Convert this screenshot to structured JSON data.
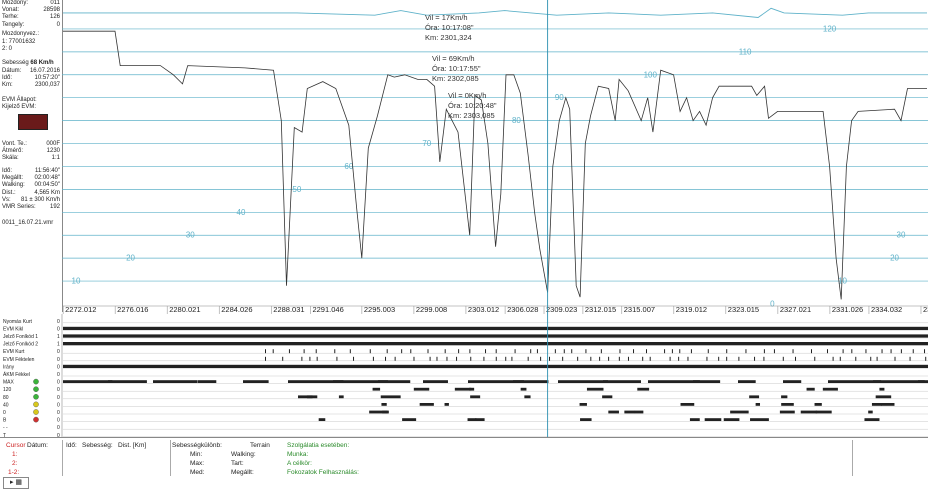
{
  "left_panel": {
    "rows_top": [
      {
        "k": "Mozdony:",
        "v": "011"
      },
      {
        "k": "Vonat:",
        "v": "28598"
      },
      {
        "k": "Terhe:",
        "v": "126"
      },
      {
        "k": "Tengely:",
        "v": "0"
      }
    ],
    "mozdonyvezeto_label": "Mozdonyvez.:",
    "mozdonyvezeto_1": "1: 77001632",
    "mozdonyvezeto_2": "2: 0",
    "sebesseg_label": "Sebesség",
    "sebesseg_value": "68 Km/h",
    "rows_mid": [
      {
        "k": "Dátum:",
        "v": "16.07.2016"
      },
      {
        "k": "Idő:",
        "v": "10:57:20\""
      },
      {
        "k": "Km:",
        "v": "2300,037"
      }
    ],
    "evm_allapot": "EVM Állapot:",
    "kijelzo_evm": "Kijelző EVM:",
    "rows_low": [
      {
        "k": "Vont. Te.:",
        "v": "000F"
      },
      {
        "k": "Átmérő:",
        "v": "1230"
      },
      {
        "k": "Skála:",
        "v": "1:1"
      }
    ],
    "rows_bottom": [
      {
        "k": "Idő:",
        "v": "11:56:40\""
      },
      {
        "k": "Megállt:",
        "v": "02:00:48\""
      },
      {
        "k": "Walking:",
        "v": "00:04:50\""
      },
      {
        "k": "Dist.:",
        "v": "4,565 Km"
      },
      {
        "k": "Vs:",
        "v": "81 ± 300 Km/h"
      },
      {
        "k": "VMR Series:",
        "v": "192"
      }
    ],
    "file": "0011_16.07.21.vmr"
  },
  "chart_data": {
    "type": "line",
    "ylim": [
      0,
      130
    ],
    "xlim": [
      2272.0,
      2338.5
    ],
    "x_tick_labels": [
      "2272.012",
      "2276.016",
      "2280.021",
      "2284.026",
      "2288.031",
      "2291.046",
      "2295.003",
      "2299.008",
      "2303.012",
      "2306.028",
      "2309.023",
      "2312.015",
      "2315.007",
      "2319.012",
      "2323.015",
      "2327.021",
      "2331.026",
      "2334.032",
      "2338.037"
    ],
    "speed_levels": [
      10,
      20,
      30,
      40,
      50,
      60,
      70,
      80,
      90,
      100,
      110,
      120
    ],
    "speed_labels": [
      {
        "v": "0",
        "x": 2326.6
      },
      {
        "v": "10",
        "x": 2273.0
      },
      {
        "v": "10",
        "x": 2332.0
      },
      {
        "v": "20",
        "x": 2277.2
      },
      {
        "v": "20",
        "x": 2336.0
      },
      {
        "v": "30",
        "x": 2281.8
      },
      {
        "v": "30",
        "x": 2336.5
      },
      {
        "v": "40",
        "x": 2285.7
      },
      {
        "v": "50",
        "x": 2290.0
      },
      {
        "v": "60",
        "x": 2294.0
      },
      {
        "v": "70",
        "x": 2300.0
      },
      {
        "v": "80",
        "x": 2306.9
      },
      {
        "v": "90",
        "x": 2310.2
      },
      {
        "v": "100",
        "x": 2317.2
      },
      {
        "v": "110",
        "x": 2324.5
      },
      {
        "v": "120",
        "x": 2331.0
      }
    ],
    "cursor_x": 2309.3,
    "speed_trace": [
      [
        2272.0,
        119
      ],
      [
        2276.0,
        119
      ],
      [
        2276.4,
        104
      ],
      [
        2279.5,
        104
      ],
      [
        2280.5,
        100
      ],
      [
        2281.2,
        96
      ],
      [
        2281.6,
        104
      ],
      [
        2286.0,
        103
      ],
      [
        2288.2,
        102
      ],
      [
        2288.8,
        80
      ],
      [
        2289.2,
        8
      ],
      [
        2289.8,
        77
      ],
      [
        2290.4,
        75
      ],
      [
        2290.8,
        94
      ],
      [
        2292.0,
        97
      ],
      [
        2293.0,
        94
      ],
      [
        2294.0,
        78
      ],
      [
        2294.6,
        42
      ],
      [
        2295.0,
        20
      ],
      [
        2295.5,
        68
      ],
      [
        2296.2,
        82
      ],
      [
        2297.0,
        100
      ],
      [
        2297.5,
        99
      ],
      [
        2298.3,
        100
      ],
      [
        2299.3,
        98
      ],
      [
        2300.0,
        98
      ],
      [
        2300.6,
        95
      ],
      [
        2301.0,
        62
      ],
      [
        2301.5,
        85
      ],
      [
        2302.4,
        75
      ],
      [
        2302.8,
        55
      ],
      [
        2303.3,
        30
      ],
      [
        2303.7,
        91
      ],
      [
        2304.2,
        89
      ],
      [
        2304.7,
        70
      ],
      [
        2305.3,
        25
      ],
      [
        2305.7,
        48
      ],
      [
        2306.1,
        100
      ],
      [
        2306.7,
        100
      ],
      [
        2307.2,
        92
      ],
      [
        2307.8,
        65
      ],
      [
        2308.3,
        40
      ],
      [
        2308.7,
        24
      ],
      [
        2309.3,
        5
      ],
      [
        2309.7,
        60
      ],
      [
        2310.2,
        80
      ],
      [
        2310.7,
        90
      ],
      [
        2311.0,
        85
      ],
      [
        2311.5,
        8
      ],
      [
        2311.8,
        3
      ],
      [
        2312.2,
        70
      ],
      [
        2312.6,
        82
      ],
      [
        2313.2,
        95
      ],
      [
        2314.0,
        94
      ],
      [
        2314.5,
        80
      ],
      [
        2314.8,
        98
      ],
      [
        2315.5,
        93
      ],
      [
        2316.5,
        80
      ],
      [
        2317.0,
        90
      ],
      [
        2317.4,
        75
      ],
      [
        2318.0,
        102
      ],
      [
        2319.0,
        100
      ],
      [
        2319.5,
        84
      ],
      [
        2320.0,
        90
      ],
      [
        2320.5,
        80
      ],
      [
        2321.0,
        84
      ],
      [
        2321.5,
        78
      ],
      [
        2322.0,
        90
      ],
      [
        2322.5,
        95
      ],
      [
        2325.0,
        95
      ],
      [
        2325.4,
        91
      ],
      [
        2326.0,
        95
      ],
      [
        2326.3,
        81
      ],
      [
        2327.0,
        84
      ],
      [
        2330.5,
        84
      ],
      [
        2331.0,
        60
      ],
      [
        2331.5,
        20
      ],
      [
        2331.9,
        2
      ],
      [
        2332.3,
        60
      ],
      [
        2332.7,
        80
      ],
      [
        2333.2,
        84
      ],
      [
        2336.0,
        85
      ],
      [
        2336.5,
        80
      ],
      [
        2337.0,
        94
      ],
      [
        2338.5,
        94
      ]
    ],
    "top_trace": [
      [
        2272.0,
        127
      ],
      [
        2276.0,
        127
      ],
      [
        2280.0,
        127
      ],
      [
        2285.0,
        127
      ],
      [
        2290.0,
        127
      ],
      [
        2296.0,
        126
      ],
      [
        2298.0,
        128
      ],
      [
        2300.0,
        126
      ],
      [
        2304.0,
        127
      ],
      [
        2306.0,
        128
      ],
      [
        2310.0,
        126
      ],
      [
        2314.0,
        127
      ],
      [
        2318.0,
        126
      ],
      [
        2322.0,
        127
      ],
      [
        2325.5,
        125
      ],
      [
        2326.5,
        129
      ],
      [
        2327.5,
        127
      ],
      [
        2332.0,
        126
      ],
      [
        2334.0,
        127
      ],
      [
        2338.5,
        127
      ]
    ],
    "annotations": [
      {
        "lines": [
          "Vil = 17Km/h",
          "Óra: 10:17:08\"",
          "Km: 2301,324"
        ]
      },
      {
        "lines": [
          "Vil = 69Km/h",
          "Óra: 10:17:55\"",
          "Km: 2302,085"
        ]
      },
      {
        "lines": [
          "Vil = 0Km/h",
          "Óra: 10:20:48\"",
          "Km: 2303,085"
        ]
      }
    ]
  },
  "digital": {
    "channels": [
      {
        "label": "Nyomás Kurt",
        "value": "0",
        "lamp": ""
      },
      {
        "label": "EVM Kikl",
        "value": "0",
        "lamp": ""
      },
      {
        "label": "Jelző Fonlkód 1",
        "value": "1",
        "lamp": ""
      },
      {
        "label": "Jelző Fonlkód 2",
        "value": "1",
        "lamp": ""
      },
      {
        "label": "EVM Kurt",
        "value": "0",
        "lamp": ""
      },
      {
        "label": "EVM Féktelen",
        "value": "0",
        "lamp": ""
      },
      {
        "label": "Irány",
        "value": "0",
        "lamp": ""
      },
      {
        "label": "ÁKM Fékkel",
        "value": "0",
        "lamp": ""
      },
      {
        "label": "MAX",
        "value": "0",
        "lamp": "green"
      },
      {
        "label": "120",
        "value": "0",
        "lamp": "green"
      },
      {
        "label": "80",
        "value": "0",
        "lamp": "green"
      },
      {
        "label": "40",
        "value": "0",
        "lamp": "yellow"
      },
      {
        "label": "0",
        "value": "0",
        "lamp": "yellow"
      },
      {
        "label": "B",
        "value": "0",
        "lamp": "red"
      },
      {
        "label": "- -",
        "value": "0",
        "lamp": ""
      },
      {
        "label": "T",
        "value": "0",
        "lamp": ""
      }
    ]
  },
  "footer": {
    "cursor": "Cursor",
    "datum": "Dátum:",
    "ido": "Idő:",
    "sebesseg": "Sebesség:",
    "dist": "Dist. [Km]",
    "sebessegkulonb": "Sebességkülönb:",
    "terrain": "Terrain",
    "szolgalat": "Szolgálatia esetében:",
    "r1": "1:",
    "r2": "2:",
    "r3": "1-2:",
    "min": "Min:",
    "max": "Max:",
    "med": "Med:",
    "walking": "Walking:",
    "tart": "Tart:",
    "megallt": "Megállt:",
    "munka": "Munka:",
    "a_celkor": "A célkör:",
    "fokozat": "Fokozatok Felhasználás:",
    "tool_icon": "▸ ▦"
  },
  "colors": {
    "grid": "#5fb2c9",
    "trace": "#333333",
    "cursor": "#2b8fb0",
    "footer_red": "#cc2222",
    "footer_green": "#2a8a2a"
  }
}
